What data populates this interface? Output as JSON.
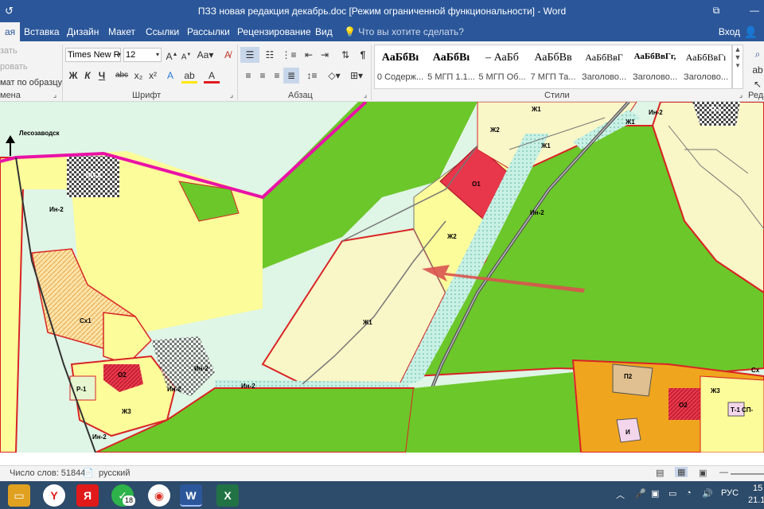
{
  "window": {
    "title": "ПЗЗ новая редакция декабрь.doc [Режим ограниченной функциональности] - Word",
    "restore_icon": "restore-icon",
    "minimize_label": "—"
  },
  "tabs": {
    "file": "ая",
    "items": [
      "Вставка",
      "Дизайн",
      "Макет",
      "Ссылки",
      "Рассылки",
      "Рецензирование",
      "Вид"
    ],
    "tell_me": "Что вы хотите сделать?",
    "sign_in": "Вход"
  },
  "clipboard": {
    "cut": "зать",
    "copy": "ровать",
    "format_painter": "мат по образцу",
    "label": "мена"
  },
  "font": {
    "name": "Times New R",
    "size": "12",
    "label": "Шрифт",
    "bold": "Ж",
    "italic": "К",
    "underline": "Ч",
    "strike": "abc",
    "sub": "x₂",
    "sup": "x²"
  },
  "paragraph": {
    "label": "Абзац"
  },
  "styles": {
    "label": "Стили",
    "items": [
      {
        "sample": "АаБбВı",
        "name": "0 Содерж..."
      },
      {
        "sample": "АаБбВı",
        "name": "5 МГП 1.1..."
      },
      {
        "sample": "– АаБб",
        "name": "5 МГП Об..."
      },
      {
        "sample": "АаБбВв",
        "name": "7 МГП Та..."
      },
      {
        "sample": "АаБбВвГ",
        "name": "Заголово..."
      },
      {
        "sample": "АаБбВвГг,",
        "name": "Заголово..."
      },
      {
        "sample": "АаБбВвГı",
        "name": "Заголово..."
      }
    ]
  },
  "editing": {
    "label": "Реда"
  },
  "map": {
    "labels": {
      "city": "Лесозаводск",
      "sp": "СП-3",
      "in2_a": "Ин-2",
      "sx1": "Сх1",
      "o2_a": "О2",
      "r1": "Р-1",
      "in2_b": "Ин-2",
      "in2_c": "Ин-2",
      "zh3_a": "Ж3",
      "in2_d": "Ин-2",
      "in2_e": "Ин-2",
      "zh1_a": "Ж1",
      "zh2_a": "Ж2",
      "o1": "О1",
      "in2_f": "Ин-2",
      "zh2_b": "Ж2",
      "zh1_b": "Ж1",
      "zh1_c": "Ж1",
      "zh1_d": "Ж1",
      "in2_g": "Ин-2",
      "p3": "П-3",
      "p2": "П2",
      "o2_b": "О2",
      "zh3_b": "Ж3",
      "t1": "Т-1",
      "i": "И",
      "sx": "Сх",
      "sp2": "СП-"
    },
    "colors": {
      "green": "#6cc72a",
      "yellow": "#fcfc9a",
      "pale_yellow": "#f9f6c7",
      "red": "#e8364a",
      "orange": "#f0a51e",
      "pink_line": "#e912a6",
      "red_line": "#d82424",
      "arrow": "#d9534f"
    }
  },
  "status": {
    "word_count": "Число слов: 51844",
    "language": "русский"
  },
  "taskbar": {
    "lang": "РУС",
    "time": "15",
    "date": "21.1",
    "badge": "18"
  }
}
